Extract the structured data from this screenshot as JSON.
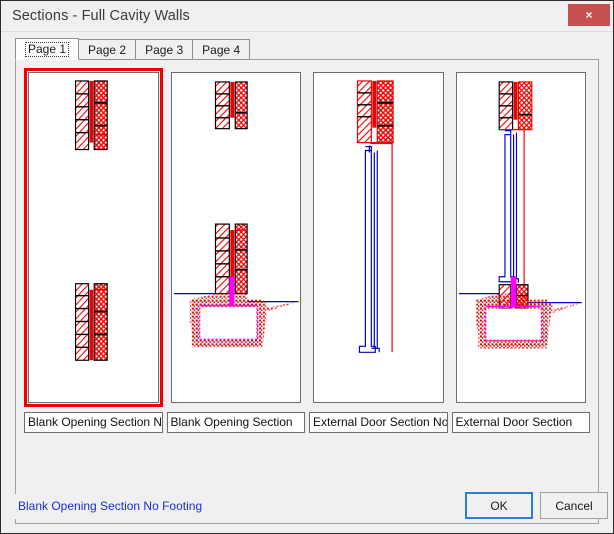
{
  "window": {
    "title": "Sections - Full Cavity Walls",
    "close_label": "×",
    "close_icon": "close-icon"
  },
  "tabs": [
    {
      "label": "Page 1",
      "active": true
    },
    {
      "label": "Page 2",
      "active": false
    },
    {
      "label": "Page 3",
      "active": false
    },
    {
      "label": "Page 4",
      "active": false
    }
  ],
  "panels": [
    {
      "name_value": "Blank Opening Section No I",
      "full_name": "Blank Opening Section No Footing",
      "selected": true,
      "drawing": "blank-opening-no-footing"
    },
    {
      "name_value": "Blank Opening Section",
      "full_name": "Blank Opening Section",
      "selected": false,
      "drawing": "blank-opening-with-footing"
    },
    {
      "name_value": "External Door Section No F",
      "full_name": "External Door Section No Footing",
      "selected": false,
      "drawing": "external-door-no-footing"
    },
    {
      "name_value": "External Door Section",
      "full_name": "External Door Section",
      "selected": false,
      "drawing": "external-door-with-footing"
    }
  ],
  "footer": {
    "status_text": "Blank Opening Section No Footing",
    "ok_label": "OK",
    "cancel_label": "Cancel"
  },
  "colors": {
    "selection": "#ef0000",
    "drawing_red": "#ee0000",
    "drawing_blue": "#0000cc",
    "drawing_magenta": "#ff00ff",
    "drawing_black": "#000000",
    "status_text": "#1a2fd0",
    "close_button": "#c75050",
    "focus_border": "#2d7dd2"
  }
}
